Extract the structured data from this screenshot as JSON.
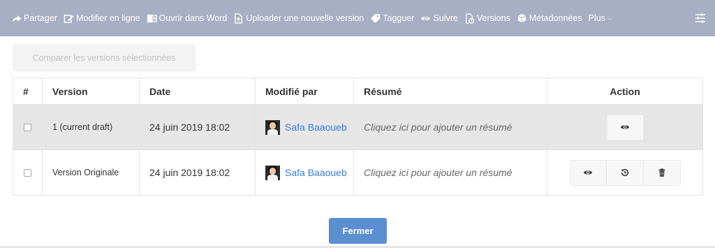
{
  "toolbar": {
    "items": [
      {
        "label": "Partager",
        "icon": "share-icon"
      },
      {
        "label": "Modifier en ligne",
        "icon": "edit-icon"
      },
      {
        "label": "Ouvrir dans Word",
        "icon": "word-icon"
      },
      {
        "label": "Uploader une nouvelle version",
        "icon": "upload-icon"
      },
      {
        "label": "Tagguer",
        "icon": "tag-icon"
      },
      {
        "label": "Suivre",
        "icon": "eye-icon"
      },
      {
        "label": "Versions",
        "icon": "versions-icon"
      },
      {
        "label": "Métadonnées",
        "icon": "cubes-icon"
      },
      {
        "label": "Plus",
        "icon": "chevron-down-icon"
      }
    ],
    "settings_icon": "sliders-icon",
    "color": "#a8aec4"
  },
  "compare_button": "Comparer les versions sélectionnées",
  "table": {
    "headers": [
      "#",
      "Version",
      "Date",
      "Modifié par",
      "Résumé",
      "Action"
    ],
    "rows": [
      {
        "version": "1 (current draft)",
        "date": "24 juin 2019 18:02",
        "user": "Safa Baaoueb",
        "summary": "Cliquez ici pour ajouter un résumé",
        "actions": [
          "eye-icon"
        ]
      },
      {
        "version": "Version Originale",
        "date": "24 juin 2019 18:02",
        "user": "Safa Baaoueb",
        "summary": "Cliquez ici pour ajouter un résumé",
        "actions": [
          "eye-icon",
          "restore-icon",
          "trash-icon"
        ]
      }
    ]
  },
  "close_button": "Fermer",
  "accent_color": "#5b8fd2",
  "link_color": "#3a7bd5"
}
